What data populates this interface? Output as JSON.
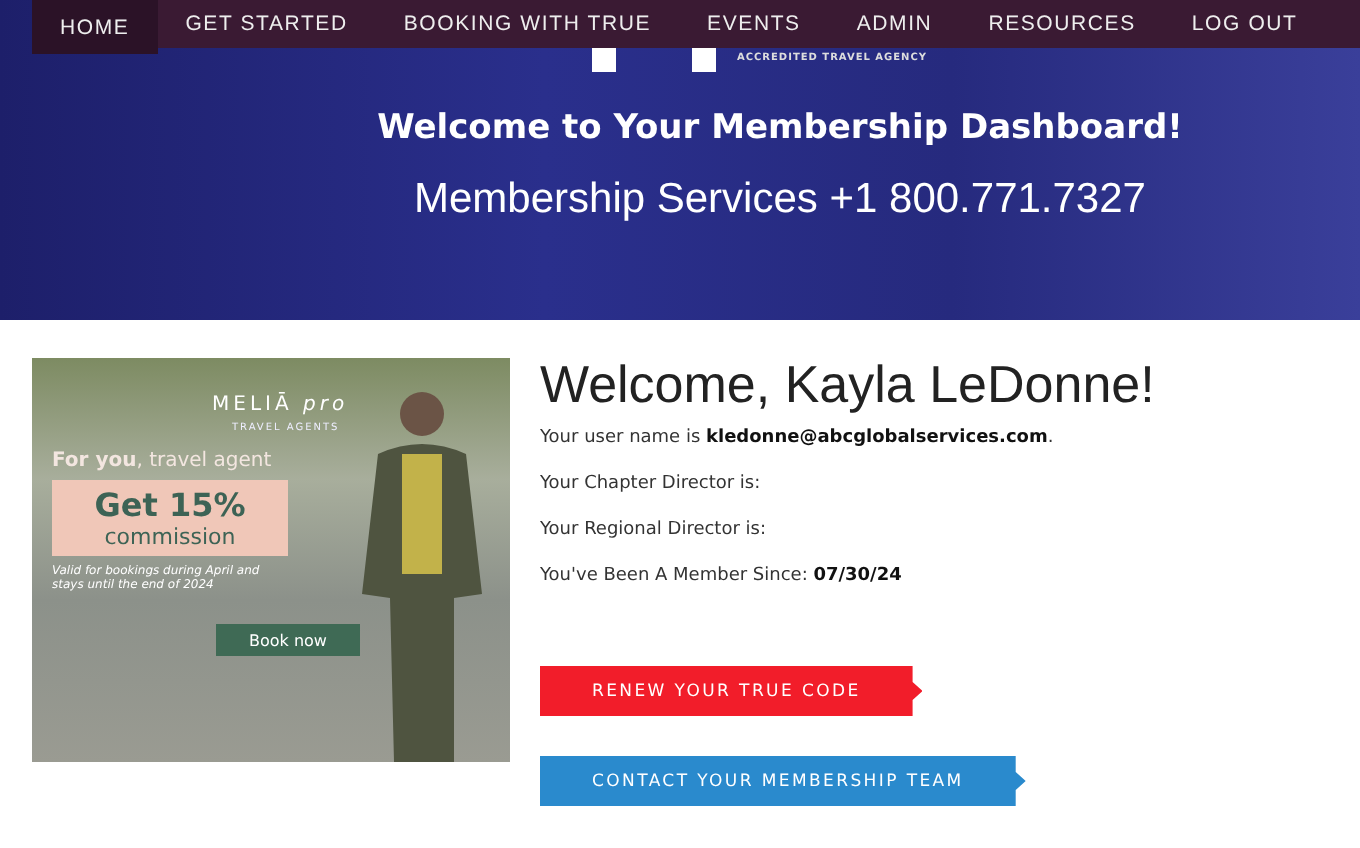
{
  "nav": {
    "items": [
      {
        "label": "HOME",
        "selected": true
      },
      {
        "label": "GET STARTED",
        "selected": false
      },
      {
        "label": "BOOKING WITH TRUE",
        "selected": false
      },
      {
        "label": "EVENTS",
        "selected": false
      },
      {
        "label": "ADMIN",
        "selected": false
      },
      {
        "label": "RESOURCES",
        "selected": false
      },
      {
        "label": "LOG OUT",
        "selected": false
      }
    ]
  },
  "hero": {
    "logo_tagline": "ACCREDITED TRAVEL AGENCY",
    "title": "Welcome to Your Membership Dashboard!",
    "phone": "Membership Services +1 800.771.7327"
  },
  "ad": {
    "brand": "MELIĀ",
    "brand_suffix": "pro",
    "subbrand": "TRAVEL AGENTS",
    "headline": "**For you**, travel agent",
    "offer": "Get 15%",
    "offer_sub": "commission",
    "terms": "Valid for bookings during April and stays until the end of 2024",
    "button": "Book now"
  },
  "welcome": {
    "title": "Welcome, Kayla LeDonne!",
    "lines": [
      "Your user name is **kledonne@abcglobalservices.com**.",
      "Your Chapter Director is:",
      "Your Regional Director is:",
      "You've Been A Member Since: **07/30/24**"
    ]
  },
  "buttons": [
    {
      "label": "RENEW YOUR TRUE CODE",
      "kind": "renew"
    },
    {
      "label": "CONTACT YOUR MEMBERSHIP TEAM",
      "kind": "contact"
    }
  ]
}
